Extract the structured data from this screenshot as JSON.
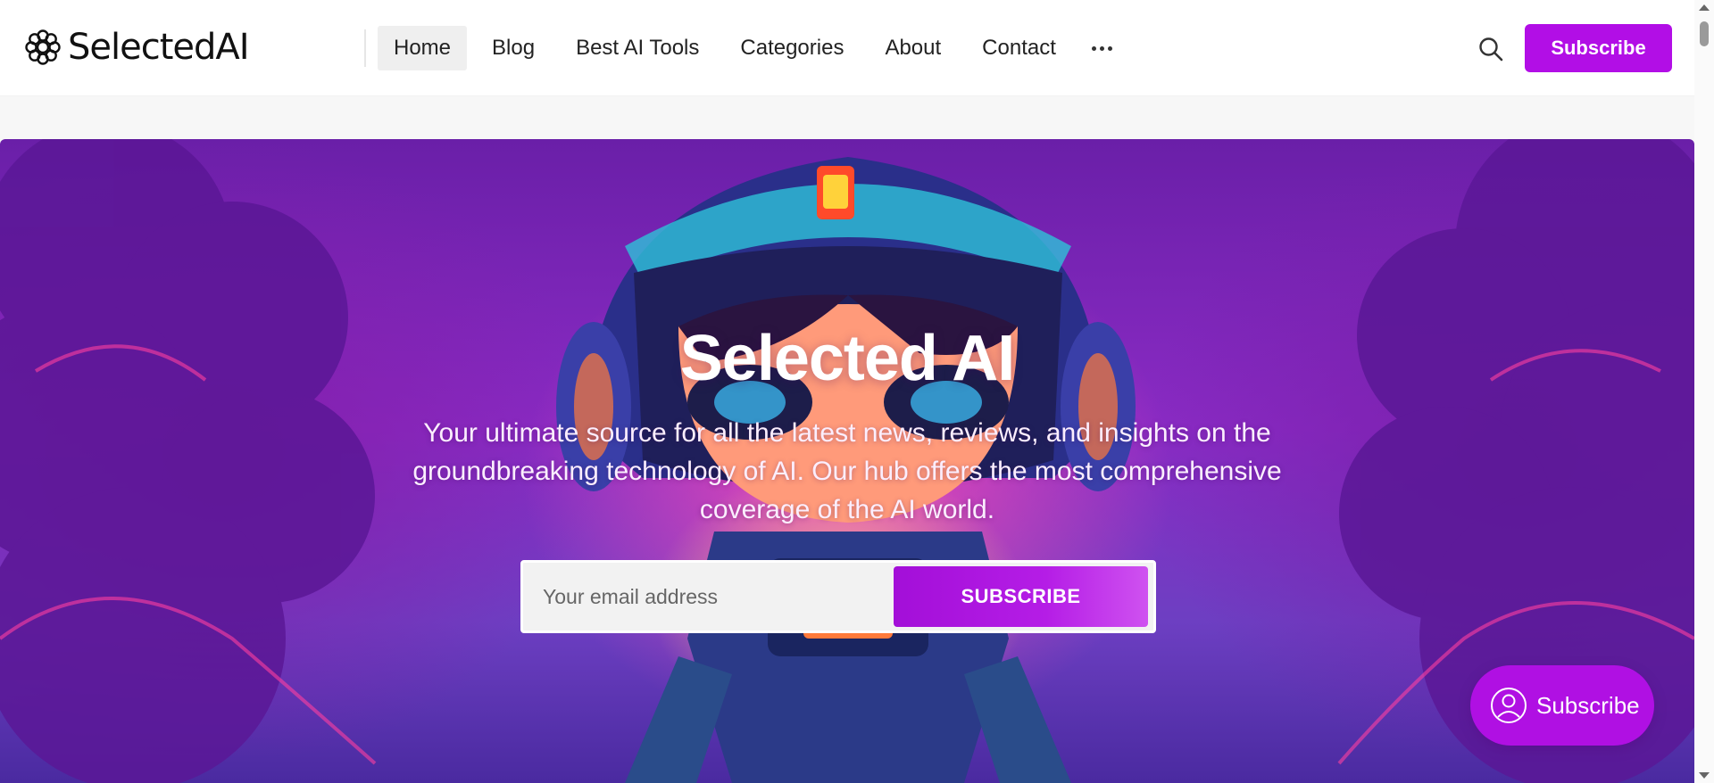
{
  "brand": {
    "name": "SelectedAI"
  },
  "nav": {
    "items": [
      {
        "label": "Home",
        "active": true
      },
      {
        "label": "Blog",
        "active": false
      },
      {
        "label": "Best AI Tools",
        "active": false
      },
      {
        "label": "Categories",
        "active": false
      },
      {
        "label": "About",
        "active": false
      },
      {
        "label": "Contact",
        "active": false
      }
    ],
    "more_icon": "more-horizontal-icon"
  },
  "header": {
    "search_icon": "search-icon",
    "subscribe_label": "Subscribe"
  },
  "hero": {
    "title": "Selected AI",
    "description": "Your ultimate source for all the latest news, reviews, and insights on the groundbreaking technology of AI. Our hub offers the most comprehensive coverage of the AI world.",
    "email_placeholder": "Your email address",
    "subscribe_button": "SUBSCRIBE"
  },
  "floating": {
    "subscribe_label": "Subscribe",
    "icon": "user-icon"
  },
  "colors": {
    "accent": "#b20ee6",
    "hero_bg": "#8a2bc4"
  }
}
